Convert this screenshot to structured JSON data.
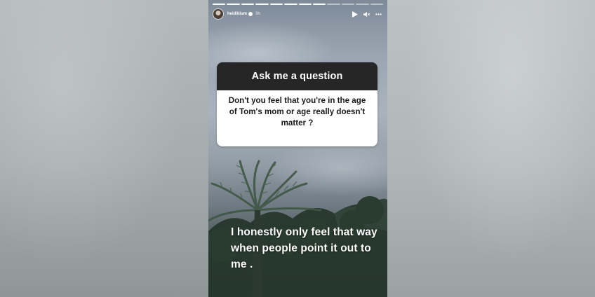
{
  "story": {
    "username": "heidiklum",
    "time": "3h",
    "progress_segments": 12,
    "progress_done": 8,
    "icons": [
      "play-icon",
      "mute-icon",
      "more-icon"
    ]
  },
  "question": {
    "header": "Ask me a question",
    "text": "Don't you feel that you're in the age of Tom's mom or age really doesn't matter ?"
  },
  "answer": {
    "text": "I honestly only feel that way when people point it out to me ."
  },
  "colors": {
    "question_header_bg": "#262626",
    "question_body_bg": "#ffffff",
    "answer_text": "#ffffff"
  }
}
